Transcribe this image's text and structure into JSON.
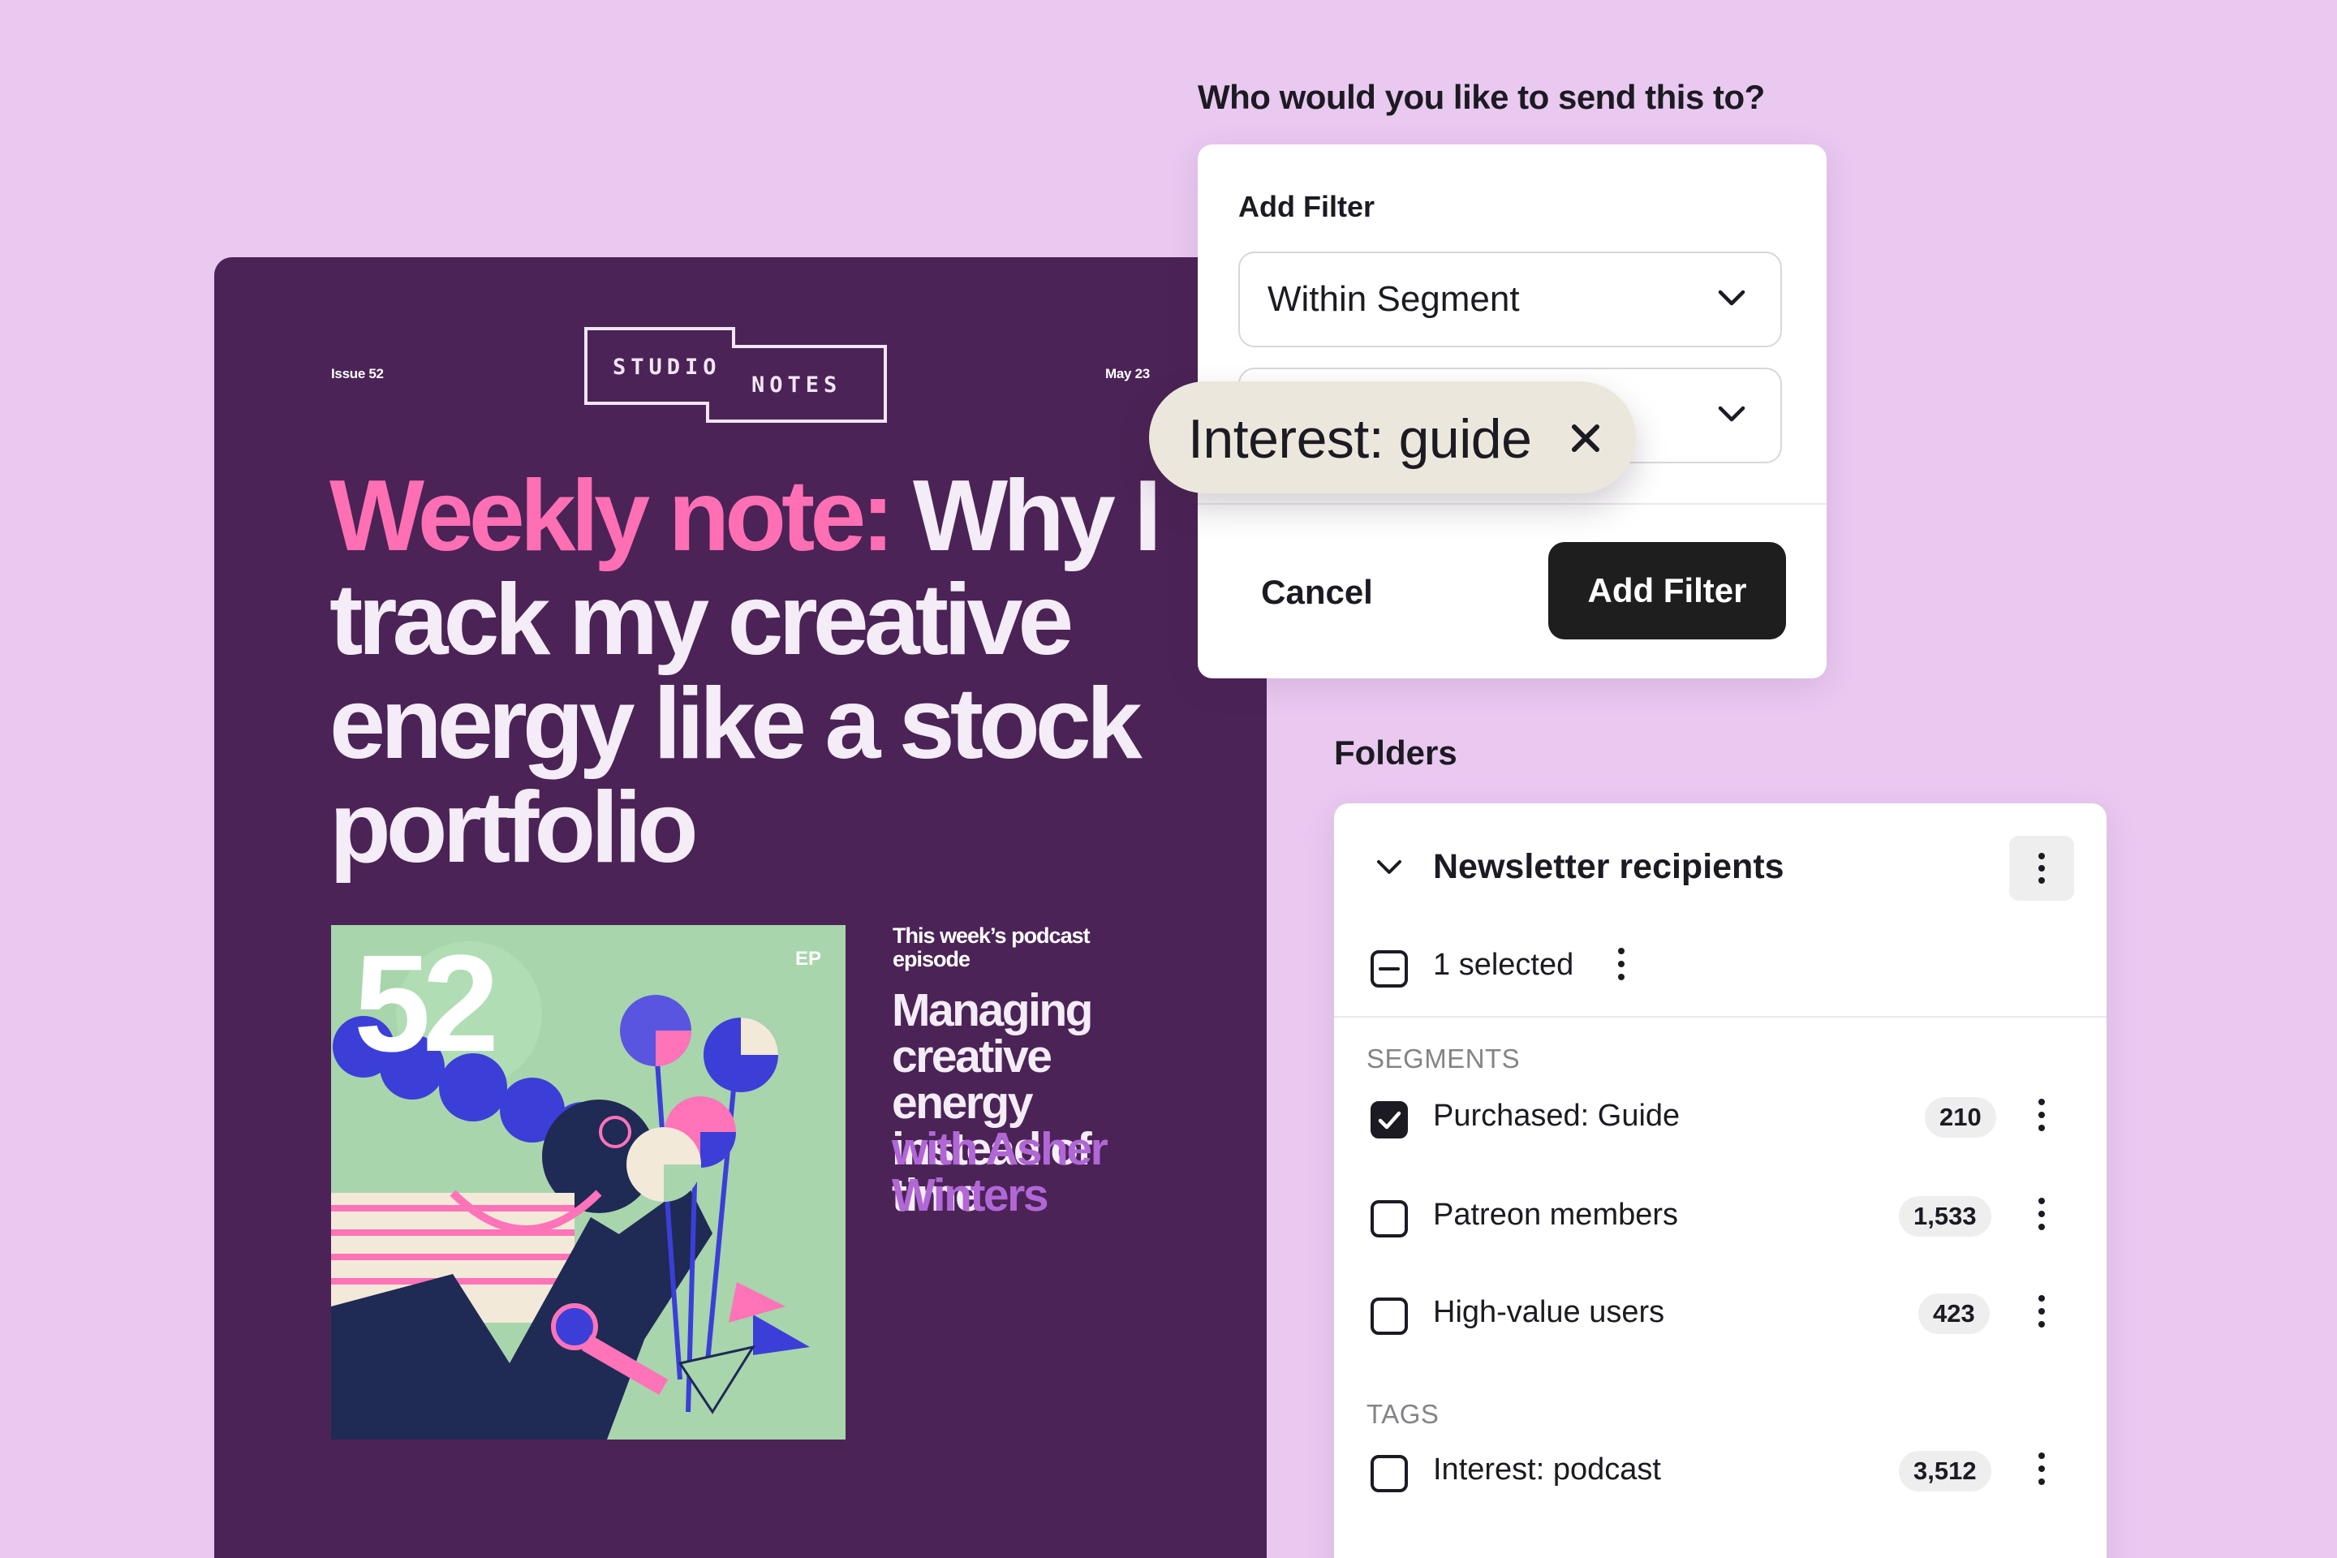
{
  "newsletter": {
    "issue": "Issue 52",
    "date": "May 23",
    "logo_word_1": "STUDIO",
    "logo_word_2": "NOTES",
    "headline_accent": "Weekly note:",
    "headline_rest": " Why I track my creative energy like a stock portfolio",
    "episode_number": "52",
    "episode_tag": "EP",
    "podcast_label": "This week’s podcast episode",
    "podcast_title": "Managing creative energy instead of time",
    "podcast_guest": "with Asher Winters"
  },
  "send_dialog": {
    "question": "Who would you like to send this to?",
    "label": "Add Filter",
    "select_1_value": "Within Segment",
    "select_2_value": "",
    "cancel_label": "Cancel",
    "add_label": "Add Filter"
  },
  "tag_pill": {
    "label": "Interest: guide",
    "remove_icon": "close-icon"
  },
  "folders": {
    "title": "Folders",
    "folder_name": "Newsletter recipients",
    "selected_text": "1 selected",
    "segments_header": "SEGMENTS",
    "segments": [
      {
        "label": "Purchased: Guide",
        "count": "210",
        "checked": true
      },
      {
        "label": "Patreon members",
        "count": "1,533",
        "checked": false
      },
      {
        "label": "High-value users",
        "count": "423",
        "checked": false
      }
    ],
    "tags_header": "TAGS",
    "tags": [
      {
        "label": "Interest: podcast",
        "count": "3,512",
        "checked": false
      }
    ]
  },
  "colors": {
    "background": "#e9c9f0",
    "newsletter_bg": "#4b2356",
    "headline_accent": "#ff6fb3",
    "podcast_guest": "#b167d6",
    "primary_button": "#1e1e1e"
  }
}
